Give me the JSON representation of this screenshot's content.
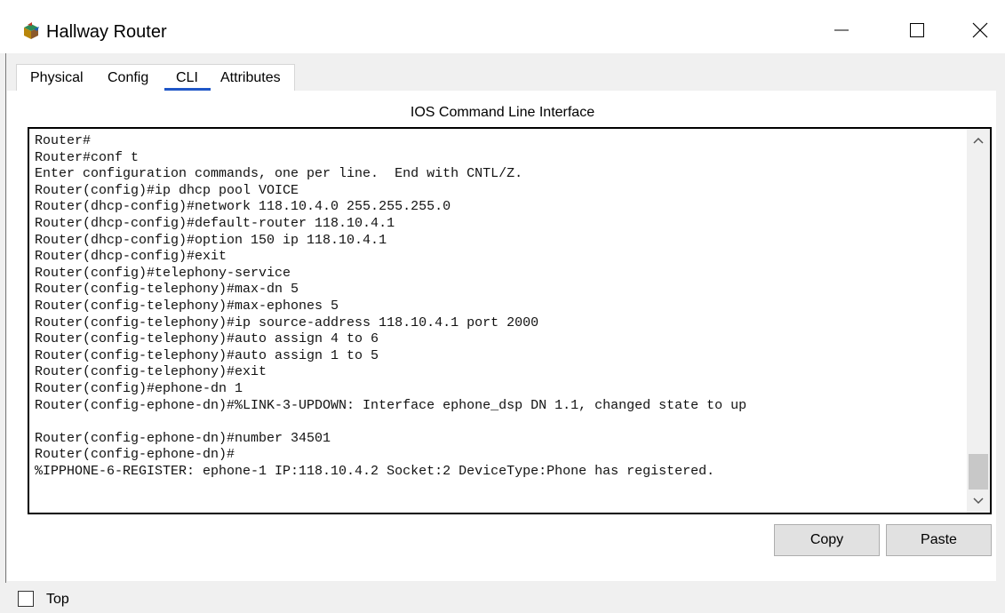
{
  "window": {
    "title": "Hallway Router",
    "icon": "router-icon"
  },
  "tabs": [
    {
      "label": "Physical",
      "active": false
    },
    {
      "label": "Config",
      "active": false
    },
    {
      "label": "CLI",
      "active": true
    },
    {
      "label": "Attributes",
      "active": false
    }
  ],
  "cli": {
    "heading": "IOS Command Line Interface",
    "lines": [
      "Router#",
      "Router#conf t",
      "Enter configuration commands, one per line.  End with CNTL/Z.",
      "Router(config)#ip dhcp pool VOICE",
      "Router(dhcp-config)#network 118.10.4.0 255.255.255.0",
      "Router(dhcp-config)#default-router 118.10.4.1",
      "Router(dhcp-config)#option 150 ip 118.10.4.1",
      "Router(dhcp-config)#exit",
      "Router(config)#telephony-service",
      "Router(config-telephony)#max-dn 5",
      "Router(config-telephony)#max-ephones 5",
      "Router(config-telephony)#ip source-address 118.10.4.1 port 2000",
      "Router(config-telephony)#auto assign 4 to 6",
      "Router(config-telephony)#auto assign 1 to 5",
      "Router(config-telephony)#exit",
      "Router(config)#ephone-dn 1",
      "Router(config-ephone-dn)#%LINK-3-UPDOWN: Interface ephone_dsp DN 1.1, changed state to up",
      "",
      "Router(config-ephone-dn)#number 34501",
      "Router(config-ephone-dn)#",
      "%IPPHONE-6-REGISTER: ephone-1 IP:118.10.4.2 Socket:2 DeviceType:Phone has registered."
    ]
  },
  "buttons": {
    "copy": "Copy",
    "paste": "Paste"
  },
  "bottom": {
    "top_label": "Top",
    "top_checked": false
  },
  "colors": {
    "active_tab_underline": "#1f56c7",
    "frame_background": "#f0f0f0"
  }
}
